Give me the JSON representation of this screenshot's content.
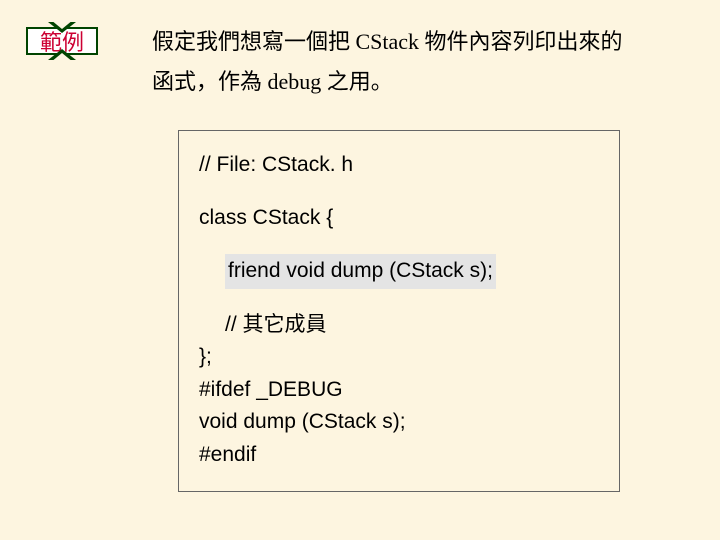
{
  "ribbon": {
    "label": "範例"
  },
  "description": {
    "line1": "假定我們想寫一個把 CStack 物件內容列印出來的",
    "line2": "函式，作為 debug 之用。"
  },
  "code": {
    "line1": "// File: CStack. h",
    "line2": "class CStack {",
    "line3": "friend void dump (CStack s);",
    "line4": "// 其它成員",
    "line5": "};",
    "line6": "#ifdef _DEBUG",
    "line7": "void dump (CStack s);",
    "line8": "#endif"
  }
}
